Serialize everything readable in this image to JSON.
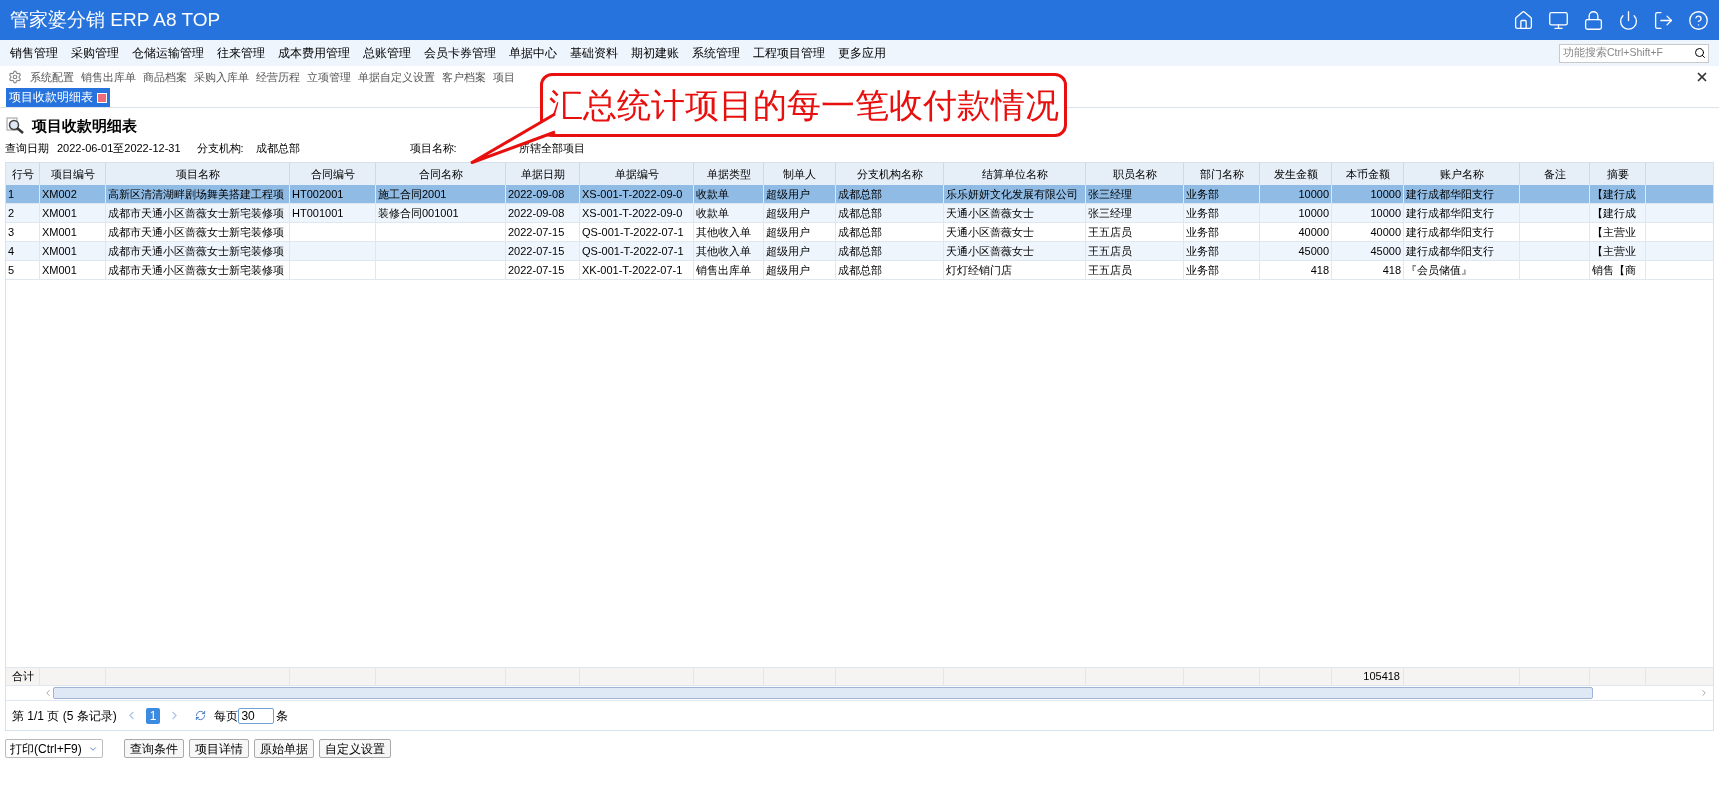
{
  "app_title": "管家婆分销 ERP A8 TOP",
  "menu": [
    "销售管理",
    "采购管理",
    "仓储运输管理",
    "往来管理",
    "成本费用管理",
    "总账管理",
    "会员卡券管理",
    "单据中心",
    "基础资料",
    "期初建账",
    "系统管理",
    "工程项目管理",
    "更多应用"
  ],
  "search": {
    "placeholder": "功能搜索Ctrl+Shift+F"
  },
  "quick_links": [
    "系统配置",
    "销售出库单",
    "商品档案",
    "采购入库单",
    "经营历程",
    "立项管理",
    "单据自定义设置",
    "客户档案",
    "项目"
  ],
  "tabs": [
    {
      "label": "项目收款明细表",
      "selected": true
    }
  ],
  "callout": "汇总统计项目的每一笔收付款情况",
  "report": {
    "title": "项目收款明细表",
    "query_date_label": "查询日期",
    "query_date": "2022-06-01至2022-12-31",
    "branch_label": "分支机构:",
    "branch": "成都总部",
    "project_label": "项目名称:",
    "project": "所辖全部项目"
  },
  "table": {
    "columns": [
      {
        "label": "行号",
        "kind": "text"
      },
      {
        "label": "项目编号",
        "kind": "text"
      },
      {
        "label": "项目名称",
        "kind": "text"
      },
      {
        "label": "合同编号",
        "kind": "text"
      },
      {
        "label": "合同名称",
        "kind": "text"
      },
      {
        "label": "单据日期",
        "kind": "text"
      },
      {
        "label": "单据编号",
        "kind": "text"
      },
      {
        "label": "单据类型",
        "kind": "text"
      },
      {
        "label": "制单人",
        "kind": "text"
      },
      {
        "label": "分支机构名称",
        "kind": "text"
      },
      {
        "label": "结算单位名称",
        "kind": "text"
      },
      {
        "label": "职员名称",
        "kind": "text"
      },
      {
        "label": "部门名称",
        "kind": "text"
      },
      {
        "label": "发生金额",
        "kind": "amount"
      },
      {
        "label": "本币金额",
        "kind": "amount",
        "total": "105418"
      },
      {
        "label": "账户名称",
        "kind": "text"
      },
      {
        "label": "备注",
        "kind": "text"
      },
      {
        "label": "摘要",
        "kind": "text"
      }
    ],
    "rows": [
      {
        "selected": true,
        "cells": [
          {
            "text": "1"
          },
          {
            "text": "XM002"
          },
          {
            "text": "高新区清清湖畔剧场舞美搭建工程项"
          },
          {
            "text": "HT002001"
          },
          {
            "text": "施工合同2001"
          },
          {
            "text": "2022-09-08"
          },
          {
            "text": "XS-001-T-2022-09-0"
          },
          {
            "text": "收款单"
          },
          {
            "text": "超级用户"
          },
          {
            "text": "成都总部"
          },
          {
            "text": "乐乐妍妍文化发展有限公司"
          },
          {
            "text": "张三经理"
          },
          {
            "text": "业务部"
          },
          {
            "text": "10000"
          },
          {
            "text": "10000"
          },
          {
            "text": "建行成都华阳支行"
          },
          {},
          {
            "text": "【建行成"
          }
        ]
      },
      {
        "selected": false,
        "cells": [
          {
            "text": "2"
          },
          {
            "text": "XM001"
          },
          {
            "text": "成都市天通小区蔷薇女士新宅装修项"
          },
          {
            "text": "HT001001"
          },
          {
            "text": "装修合同001001"
          },
          {
            "text": "2022-09-08"
          },
          {
            "text": "XS-001-T-2022-09-0"
          },
          {
            "text": "收款单"
          },
          {
            "text": "超级用户"
          },
          {
            "text": "成都总部"
          },
          {
            "text": "天通小区蔷薇女士"
          },
          {
            "text": "张三经理"
          },
          {
            "text": "业务部"
          },
          {
            "text": "10000"
          },
          {
            "text": "10000"
          },
          {
            "text": "建行成都华阳支行"
          },
          {},
          {
            "text": "【建行成"
          }
        ]
      },
      {
        "selected": false,
        "cells": [
          {
            "text": "3"
          },
          {
            "text": "XM001"
          },
          {
            "text": "成都市天通小区蔷薇女士新宅装修项"
          },
          {},
          {},
          {
            "text": "2022-07-15"
          },
          {
            "text": "QS-001-T-2022-07-1"
          },
          {
            "text": "其他收入单"
          },
          {
            "text": "超级用户"
          },
          {
            "text": "成都总部"
          },
          {
            "text": "天通小区蔷薇女士"
          },
          {
            "text": "王五店员"
          },
          {
            "text": "业务部"
          },
          {
            "text": "40000"
          },
          {
            "text": "40000"
          },
          {
            "text": "建行成都华阳支行"
          },
          {},
          {
            "text": "【主营业"
          }
        ]
      },
      {
        "selected": false,
        "cells": [
          {
            "text": "4"
          },
          {
            "text": "XM001"
          },
          {
            "text": "成都市天通小区蔷薇女士新宅装修项"
          },
          {},
          {},
          {
            "text": "2022-07-15"
          },
          {
            "text": "QS-001-T-2022-07-1"
          },
          {
            "text": "其他收入单"
          },
          {
            "text": "超级用户"
          },
          {
            "text": "成都总部"
          },
          {
            "text": "天通小区蔷薇女士"
          },
          {
            "text": "王五店员"
          },
          {
            "text": "业务部"
          },
          {
            "text": "45000"
          },
          {
            "text": "45000"
          },
          {
            "text": "建行成都华阳支行"
          },
          {},
          {
            "text": "【主营业"
          }
        ]
      },
      {
        "selected": false,
        "cells": [
          {
            "text": "5"
          },
          {
            "text": "XM001"
          },
          {
            "text": "成都市天通小区蔷薇女士新宅装修项"
          },
          {},
          {},
          {
            "text": "2022-07-15"
          },
          {
            "text": "XK-001-T-2022-07-1"
          },
          {
            "text": "销售出库单"
          },
          {
            "text": "超级用户"
          },
          {
            "text": "成都总部"
          },
          {
            "text": "灯灯经销门店"
          },
          {
            "text": "王五店员"
          },
          {
            "text": "业务部"
          },
          {
            "text": "418"
          },
          {
            "text": "418"
          },
          {
            "text": "『会员储值』"
          },
          {},
          {
            "text": "销售【商"
          }
        ]
      }
    ],
    "total_label": "合计"
  },
  "pager": {
    "info": "第 1/1 页 (5 条记录)",
    "pages": [
      {
        "label": "1",
        "selected": true
      }
    ],
    "per_page_label": "每页",
    "per_page": "30",
    "unit": "条"
  },
  "buttons": [
    {
      "label": "打印(Ctrl+F9)",
      "kind": "dropdown"
    },
    {
      "label": "查询条件",
      "kind": "button"
    },
    {
      "label": "项目详情",
      "kind": "button"
    },
    {
      "label": "原始单据",
      "kind": "button"
    },
    {
      "label": "自定义设置",
      "kind": "button"
    }
  ]
}
